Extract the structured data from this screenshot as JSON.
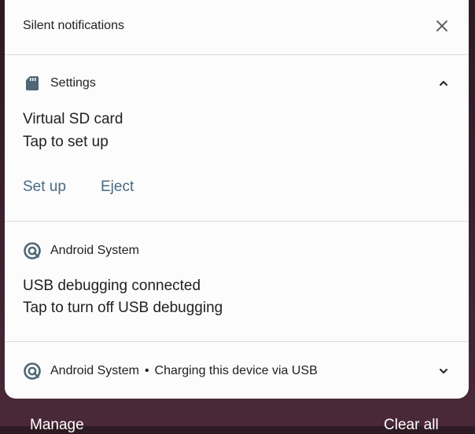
{
  "header": {
    "title": "Silent notifications",
    "close_icon": "close-icon"
  },
  "notifications": [
    {
      "app_name": "Settings",
      "icon": "sd-card-icon",
      "expand_icon": "chevron-up-icon",
      "title": "Virtual SD card",
      "text": "Tap to set up",
      "actions": [
        "Set up",
        "Eject"
      ]
    },
    {
      "app_name": "Android System",
      "icon": "android-system-icon",
      "title": "USB debugging connected",
      "text": "Tap to turn off USB debugging"
    },
    {
      "app_name": "Android System",
      "separator": "•",
      "summary": "Charging this device via USB",
      "icon": "android-system-icon",
      "expand_icon": "chevron-down-icon"
    }
  ],
  "footer": {
    "manage_label": "Manage",
    "clear_all_label": "Clear all"
  },
  "colors": {
    "panel_bg": "#fcfcfc",
    "accent_action": "#4a6b82",
    "text_primary": "#202124",
    "backdrop": "#3d2230"
  }
}
